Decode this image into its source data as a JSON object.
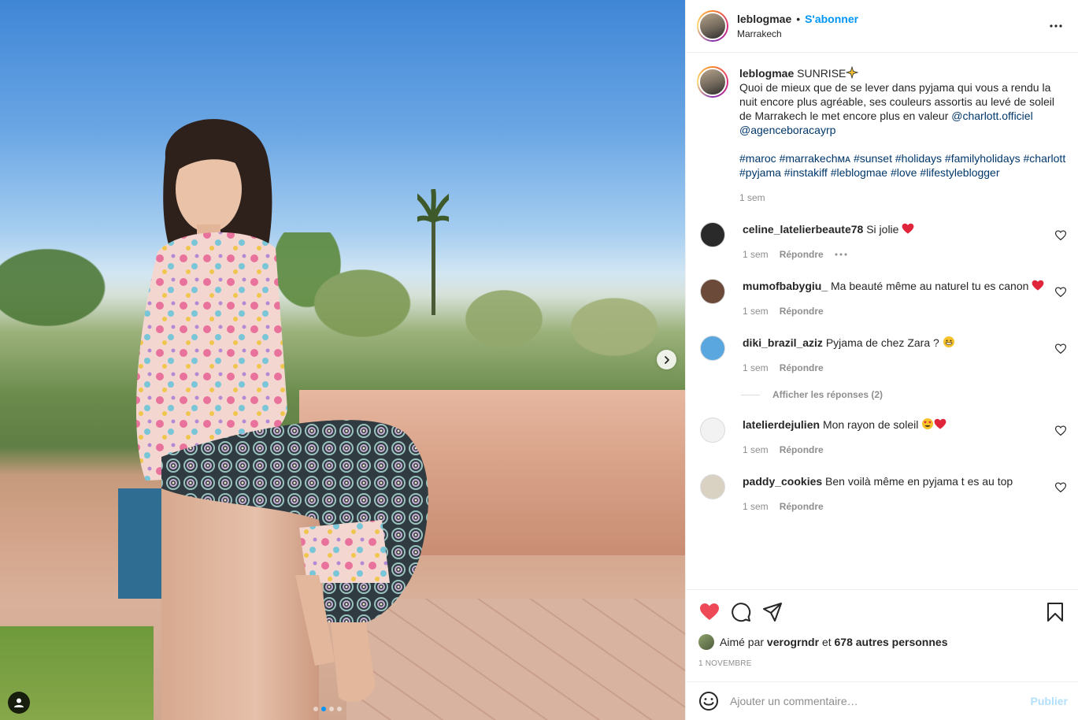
{
  "post": {
    "username": "leblogmae",
    "bullet": "•",
    "follow_label": "S'abonner",
    "location": "Marrakech"
  },
  "caption": {
    "username": "leblogmae",
    "title": "SUNRISE",
    "text": "Quoi de mieux que de se lever dans pyjama qui vous a rendu la nuit encore plus agréable, ses couleurs assortis au levé de soleil de Marrakech le met encore plus en valeur",
    "mention1": "@charlott.officiel",
    "mention2": "@agenceboracayrp",
    "hashtags": "#maroc #marrakechᴍᴀ #sunset #holidays #familyholidays #charlott #pyjama #instakiff #leblogmae #love #lifestyleblogger",
    "time": "1 sem"
  },
  "comments": [
    {
      "username": "celine_latelierbeaute78",
      "text": "Si jolie",
      "time": "1 sem",
      "reply": "Répondre",
      "avatar_color": "#2a2a2a",
      "emoji": "red-heart"
    },
    {
      "username": "mumofbabygiu_",
      "text": "Ma beauté même au naturel tu es canon",
      "time": "1 sem",
      "reply": "Répondre",
      "avatar_color": "#6b4a3a",
      "emoji": "red-heart"
    },
    {
      "username": "diki_brazil_aziz",
      "text": "Pyjama de chez Zara ?",
      "time": "1 sem",
      "reply": "Répondre",
      "avatar_color": "#5aa7e0",
      "emoji": "grinning-face"
    },
    {
      "username": "latelierdejulien",
      "text": "Mon rayon de soleil",
      "time": "1 sem",
      "reply": "Répondre",
      "avatar_color": "#f2f2f2",
      "emoji": "heart-eyes"
    },
    {
      "username": "paddy_cookies",
      "text": "Ben voilà même en pyjama t es au top",
      "time": "1 sem",
      "reply": "Répondre",
      "avatar_color": "#d9d2c3",
      "emoji": ""
    }
  ],
  "view_replies": "Afficher les réponses (2)",
  "likes": {
    "prefix": "Aimé par",
    "user": "verogrndr",
    "connector": "et",
    "others": "678 autres personnes"
  },
  "date": "1 NOVEMBRE",
  "add_comment": {
    "placeholder": "Ajouter un commentaire…",
    "publish": "Publier"
  },
  "carousel": {
    "count": 4,
    "active": 1
  },
  "colors": {
    "accent": "#0095f6",
    "like_red": "#ed4956",
    "text": "#262626",
    "muted": "#8e8e8e",
    "publish_disabled": "#b2dffc"
  }
}
